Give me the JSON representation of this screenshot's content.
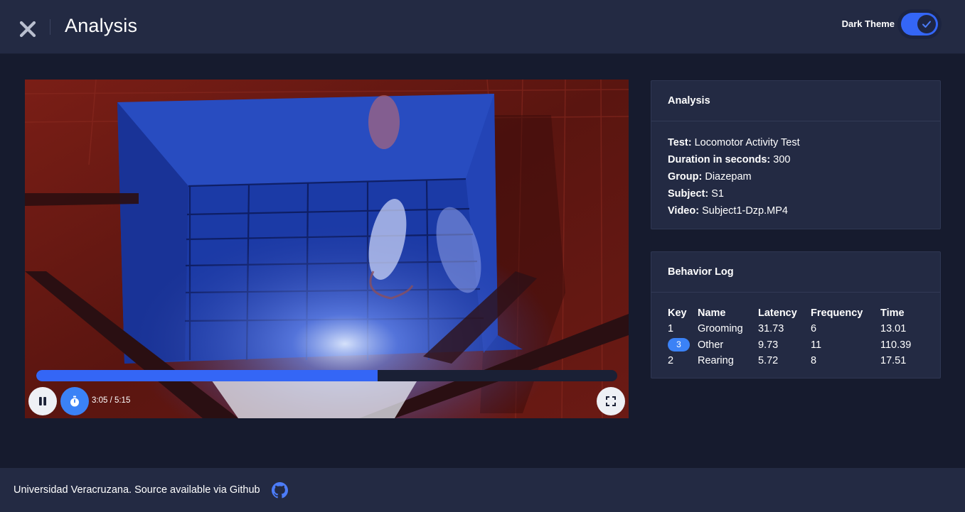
{
  "header": {
    "title": "Analysis",
    "theme_label": "Dark Theme",
    "theme_enabled": true
  },
  "player": {
    "time_readout": "3:05 / 5:15",
    "progress_fraction": 0.5873,
    "icons": {
      "close": "close-icon",
      "pause": "pause-icon",
      "timer": "stopwatch-icon",
      "fullscreen": "fullscreen-icon"
    }
  },
  "analysis": {
    "title": "Analysis",
    "fields": [
      {
        "label": "Test:",
        "value": "Locomotor Activity Test"
      },
      {
        "label": "Duration in seconds:",
        "value": "300"
      },
      {
        "label": "Group:",
        "value": "Diazepam"
      },
      {
        "label": "Subject:",
        "value": "S1"
      },
      {
        "label": "Video:",
        "value": "Subject1-Dzp.MP4"
      }
    ]
  },
  "behavior_log": {
    "title": "Behavior Log",
    "columns": [
      "Key",
      "Name",
      "Latency",
      "Frequency",
      "Time"
    ],
    "rows": [
      {
        "key": "1",
        "name": "Grooming",
        "latency": "31.73",
        "frequency": "6",
        "time": "13.01",
        "active": false
      },
      {
        "key": "3",
        "name": "Other",
        "latency": "9.73",
        "frequency": "11",
        "time": "110.39",
        "active": true
      },
      {
        "key": "2",
        "name": "Rearing",
        "latency": "5.72",
        "frequency": "8",
        "time": "17.51",
        "active": false
      }
    ]
  },
  "footer": {
    "text": "Universidad Veracruzana. Source available via Github"
  },
  "colors": {
    "accent": "#3466f6",
    "badge": "#3b82f6",
    "background": "#161b2e",
    "panel": "#232a43"
  }
}
